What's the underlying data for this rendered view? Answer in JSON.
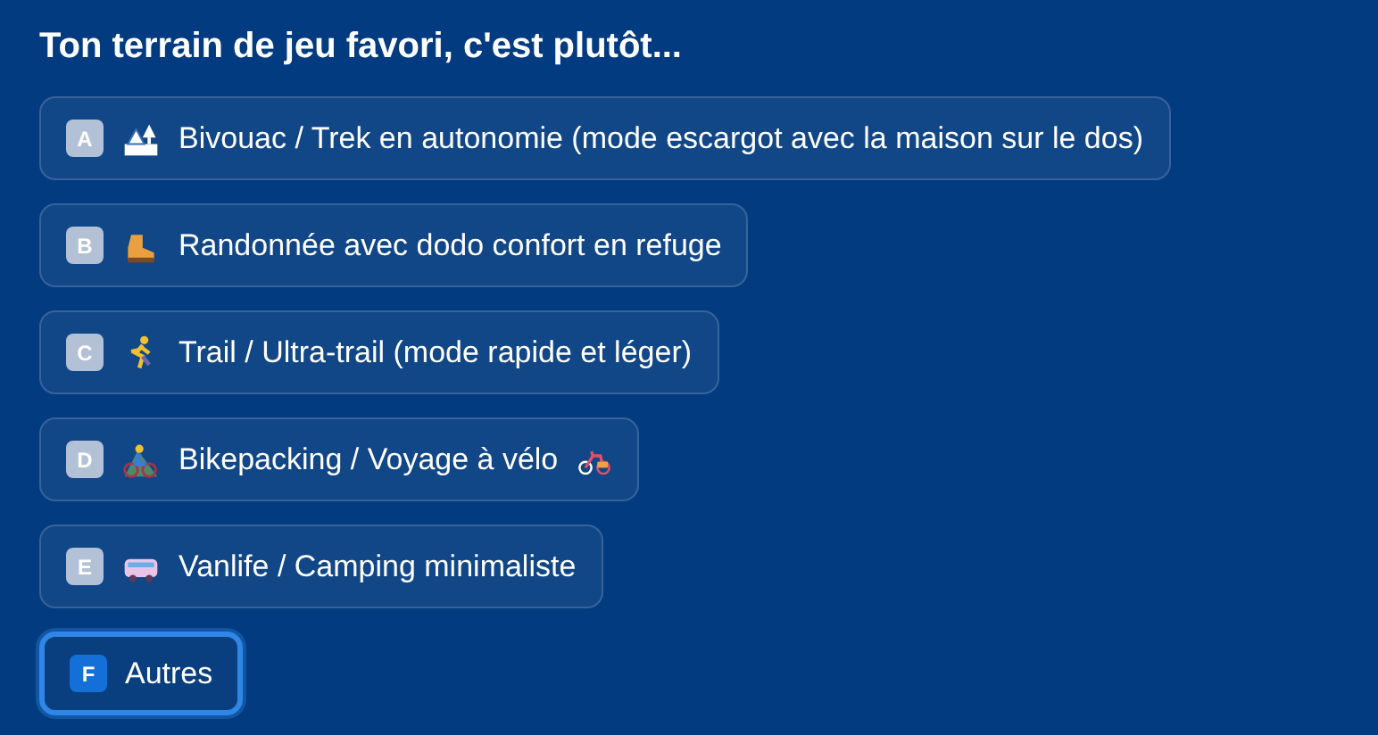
{
  "question": "Ton terrain de jeu favori, c'est plutôt...",
  "options": [
    {
      "letter": "A",
      "label": "Bivouac / Trek en autonomie (mode escargot avec la maison sur le dos)",
      "selected": false
    },
    {
      "letter": "B",
      "label": "Randonnée avec dodo confort en refuge",
      "selected": false
    },
    {
      "letter": "C",
      "label": "Trail / Ultra-trail (mode rapide et léger)",
      "selected": false
    },
    {
      "letter": "D",
      "label": "Bikepacking / Voyage à vélo",
      "selected": false
    },
    {
      "letter": "E",
      "label": "Vanlife / Camping minimaliste",
      "selected": false
    },
    {
      "letter": "F",
      "label": "Autres",
      "selected": true
    }
  ]
}
